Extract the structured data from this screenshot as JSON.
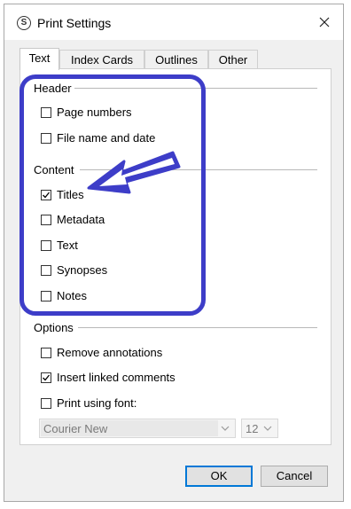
{
  "window": {
    "title": "Print Settings",
    "app_icon_glyph": "S"
  },
  "tabs": [
    {
      "label": "Text",
      "active": true
    },
    {
      "label": "Index Cards",
      "active": false
    },
    {
      "label": "Outlines",
      "active": false
    },
    {
      "label": "Other",
      "active": false
    }
  ],
  "header_group": {
    "title": "Header",
    "items": [
      {
        "label": "Page numbers",
        "checked": false
      },
      {
        "label": "File name and date",
        "checked": false
      }
    ]
  },
  "content_group": {
    "title": "Content",
    "items": [
      {
        "label": "Titles",
        "checked": true
      },
      {
        "label": "Metadata",
        "checked": false
      },
      {
        "label": "Text",
        "checked": false
      },
      {
        "label": "Synopses",
        "checked": false
      },
      {
        "label": "Notes",
        "checked": false
      }
    ]
  },
  "options_group": {
    "title": "Options",
    "items": [
      {
        "label": "Remove annotations",
        "checked": false
      },
      {
        "label": "Insert linked comments",
        "checked": true
      },
      {
        "label": "Print using font:",
        "checked": false
      }
    ]
  },
  "font": {
    "name": "Courier New",
    "size": "12",
    "enabled": false
  },
  "buttons": {
    "ok": "OK",
    "cancel": "Cancel"
  },
  "annotation": {
    "color": "#3d3dc8",
    "target": "Titles"
  }
}
